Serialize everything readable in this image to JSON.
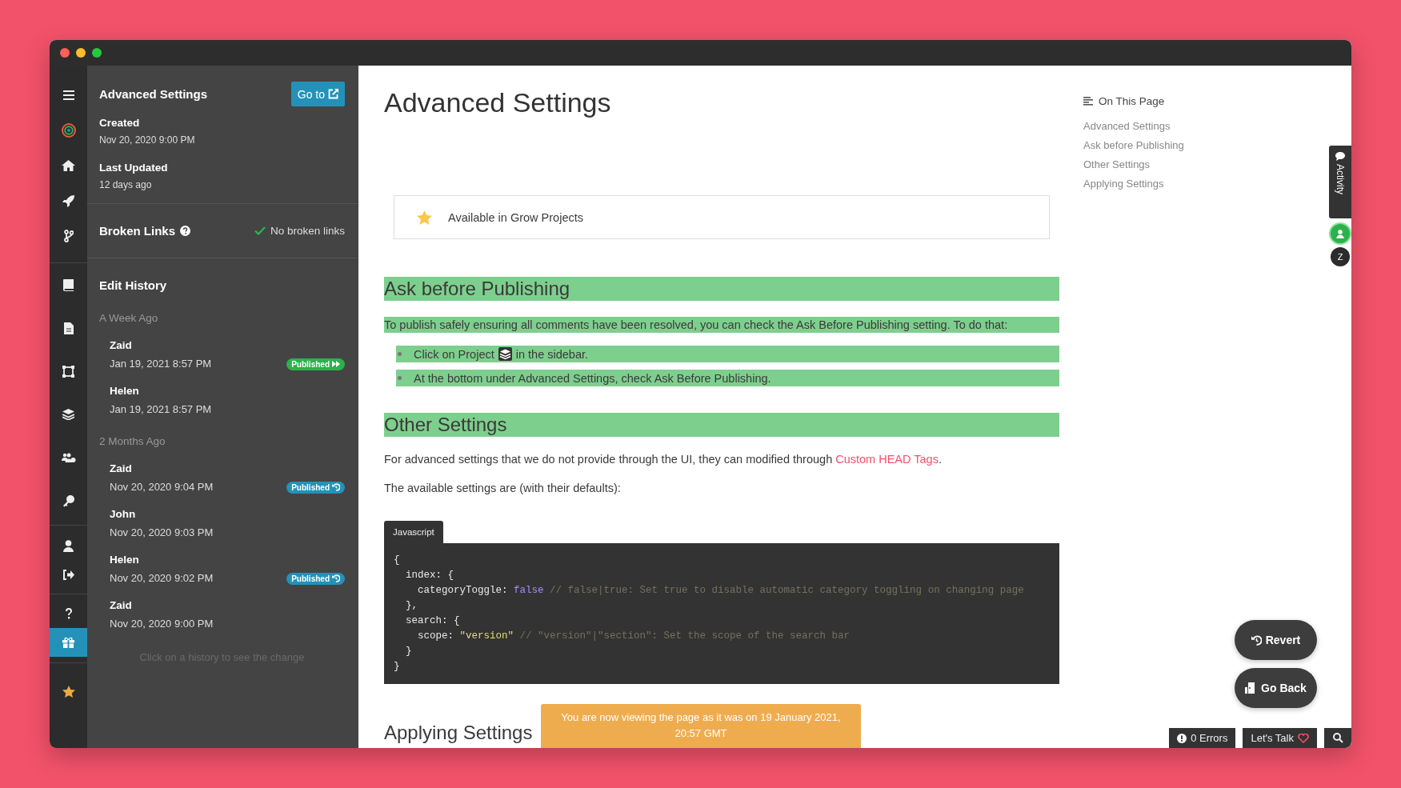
{
  "window": {
    "traffic_lights": [
      {
        "color": "#fe5f57"
      },
      {
        "color": "#febc2e"
      },
      {
        "color": "#28c840"
      }
    ]
  },
  "rail_groups": [
    [
      {
        "selected": false
      },
      {
        "selected": false
      },
      {
        "selected": false
      },
      {
        "selected": false
      },
      {
        "selected": false
      }
    ],
    [
      {
        "selected": false
      },
      {
        "selected": false
      },
      {
        "selected": false
      },
      {
        "selected": false
      },
      {
        "selected": false
      },
      {
        "selected": false
      }
    ],
    [
      {
        "selected": false
      },
      {
        "selected": false
      }
    ],
    [
      {
        "selected": false
      },
      {
        "selected": true
      }
    ],
    [
      {
        "selected": false
      }
    ]
  ],
  "panel": {
    "title": "Advanced Settings",
    "goto_button": "Go to",
    "meta": [
      {
        "label": "Created",
        "value": "Nov 20, 2020 9:00 PM"
      },
      {
        "label": "Last Updated",
        "value": "12 days ago"
      }
    ],
    "broken_links": {
      "title": "Broken Links",
      "status": "No broken links"
    },
    "history": {
      "title": "Edit History",
      "groups": [
        {
          "label": "A Week Ago",
          "entries": [
            {
              "name": "Zaid",
              "date": "Jan 19, 2021 8:57 PM",
              "badge": {
                "label": "Published",
                "kind": "forward",
                "color": "#2bb24c"
              }
            },
            {
              "name": "Helen",
              "date": "Jan 19, 2021 8:57 PM"
            }
          ]
        },
        {
          "label": "2 Months Ago",
          "entries": [
            {
              "name": "Zaid",
              "date": "Nov 20, 2020 9:04 PM",
              "badge": {
                "label": "Published",
                "kind": "revert",
                "color": "#2492b8"
              }
            },
            {
              "name": "John",
              "date": "Nov 20, 2020 9:03 PM"
            },
            {
              "name": "Helen",
              "date": "Nov 20, 2020 9:02 PM",
              "badge": {
                "label": "Published",
                "kind": "revert",
                "color": "#2492b8"
              }
            },
            {
              "name": "Zaid",
              "date": "Nov 20, 2020 9:00 PM"
            }
          ]
        }
      ],
      "hint": "Click on a history to see the change"
    }
  },
  "article": {
    "title": "Advanced Settings",
    "callout": "Available in Grow Projects",
    "blocks": [
      {
        "kind": "heading",
        "text": "Ask before Publishing",
        "highlighted": true
      },
      {
        "kind": "paragraph",
        "text": "To publish safely ensuring all comments have been resolved, you can check the Ask Before Publishing setting. To do that:",
        "highlighted": true
      },
      {
        "kind": "list",
        "items": [
          {
            "before": "Click on Project",
            "inline_icon": true,
            "after": "in the sidebar.",
            "highlighted": true
          },
          {
            "before": "At the bottom under Advanced Settings, check Ask Before Publishing.",
            "inline_icon": false,
            "highlighted": true
          }
        ]
      },
      {
        "kind": "heading",
        "text": "Other Settings",
        "highlighted": true
      },
      {
        "kind": "paragraph",
        "text": "For advanced settings that we do not provide through the UI, they can modified through",
        "link": "Custom HEAD Tags",
        "after": ".",
        "highlighted": false
      },
      {
        "kind": "paragraph",
        "text": "The available settings are (with their defaults):",
        "highlighted": false
      },
      {
        "kind": "code",
        "language": "Javascript",
        "lines": [
          [
            {
              "t": "{",
              "kind": "plain"
            }
          ],
          [
            {
              "t": "  index: {",
              "kind": "plain"
            }
          ],
          [
            {
              "t": "    categoryToggle: ",
              "kind": "plain"
            },
            {
              "t": "false",
              "kind": "keyword"
            },
            {
              "t": " // false|true: Set true to disable automatic category toggling on changing page",
              "kind": "comment"
            }
          ],
          [
            {
              "t": "  },",
              "kind": "plain"
            }
          ],
          [
            {
              "t": "  search: {",
              "kind": "plain"
            }
          ],
          [
            {
              "t": "    scope: ",
              "kind": "plain"
            },
            {
              "t": "\"version\"",
              "kind": "string"
            },
            {
              "t": " // \"version\"|\"section\": Set the scope of the search bar",
              "kind": "comment"
            }
          ],
          [
            {
              "t": "  }",
              "kind": "plain"
            }
          ],
          [
            {
              "t": "}",
              "kind": "plain"
            }
          ]
        ]
      },
      {
        "kind": "heading",
        "text": "Applying Settings",
        "highlighted": false
      }
    ]
  },
  "toc": {
    "title": "On This Page",
    "items": [
      "Advanced Settings",
      "Ask before Publishing",
      "Other Settings",
      "Applying Settings"
    ]
  },
  "activity_tab": "Activity",
  "avatars": [
    {
      "kind": "icon",
      "color": "#2bb24c"
    },
    {
      "kind": "initial",
      "initial": "Z",
      "color": "#2c2c2c"
    }
  ],
  "toast": "You are now viewing the page as it was on 19 January 2021, 20:57 GMT",
  "actions": [
    {
      "label": "Revert",
      "kind": "revert"
    },
    {
      "label": "Go Back",
      "kind": "back"
    }
  ],
  "status_bar": {
    "errors": "0 Errors",
    "talk": "Let's Talk"
  }
}
